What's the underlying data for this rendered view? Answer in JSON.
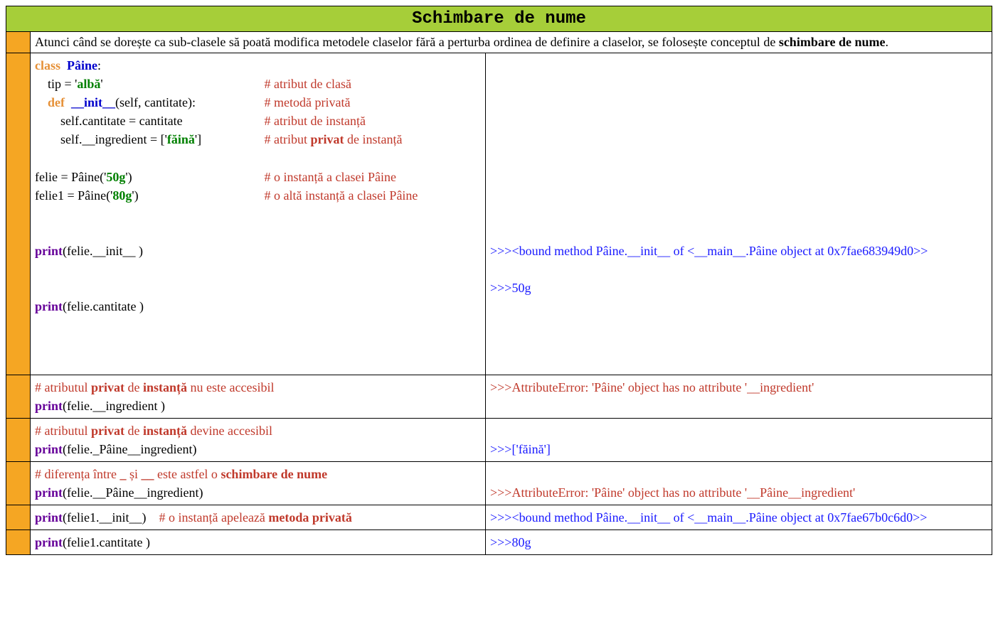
{
  "title": "Schimbare de nume",
  "intro": {
    "t1": "Atunci când se dorește ca sub-clasele să poată modifica metodele claselor fără a perturba ordinea de definire a claselor, se folosește conceptul de ",
    "t2": "schimbare de nume",
    "t3": "."
  },
  "code_main": {
    "l1_class": "class",
    "l1_name": "Pâine",
    "l1_colon": ":",
    "l2_lhs": "tip = '",
    "l2_val": "albă",
    "l2_rhs": "'",
    "l2_cmt": "# atribut de clasă",
    "l3_def": "def",
    "l3_fn": "__init__",
    "l3_sig": "(self, cantitate):",
    "l3_cmt": "# metodă privată",
    "l4_txt": "self.cantitate = cantitate",
    "l4_cmt": "# atribut de instanță",
    "l5_lhs": "self.__ingredient = ['",
    "l5_val": "făină",
    "l5_rhs": "']",
    "l5_cmt_a": "# atribut ",
    "l5_cmt_b": "privat",
    "l5_cmt_c": " de instanță",
    "l6_lhs": "felie = Pâine('",
    "l6_val": "50g",
    "l6_rhs": "')",
    "l6_cmt": "# o instanță a clasei Pâine",
    "l7_lhs": "felie1 = Pâine('",
    "l7_val": "80g",
    "l7_rhs": "')",
    "l7_cmt": "# o altă instanță a clasei Pâine",
    "l8_fn": "print",
    "l8_arg": "(felie.__init__ )",
    "l9_fn": "print",
    "l9_arg": "(felie.cantitate )"
  },
  "out_main": {
    "o1": ">>><bound method Pâine.__init__ of <__main__.Pâine object at 0x7fae683949d0>>",
    "o2": ">>>50g"
  },
  "row_err1": {
    "c1a": "# atributul ",
    "c1b": "privat",
    "c1c": " de ",
    "c1d": "instanță",
    "c1e": " nu este accesibil",
    "p_fn": "print",
    "p_arg": "(felie.__ingredient )",
    "out": ">>>AttributeError: 'Pâine' object has no attribute '__ingredient'"
  },
  "row_ok": {
    "c1a": "# atributul ",
    "c1b": "privat",
    "c1c": " de ",
    "c1d": "instanță",
    "c1e": " devine accesibil",
    "p_fn": "print",
    "p_arg": "(felie._Pâine__ingredient)",
    "out": ">>>['făină']"
  },
  "row_diff": {
    "c1a": "# diferența între ",
    "c1b": "_",
    "c1c": " și ",
    "c1d": "__",
    "c1e": " este astfel o ",
    "c1f": "schimbare de nume",
    "p_fn": "print",
    "p_arg": "(felie.__Pâine__ingredient)",
    "out": ">>>AttributeError: 'Pâine' object has no attribute '__Pâine__ingredient'"
  },
  "row_m2": {
    "p_fn": "print",
    "p_arg": "(felie1.__init__)",
    "c_a": "# o instanță apelează ",
    "c_b": "metoda privată",
    "out": ">>><bound method Pâine.__init__ of <__main__.Pâine object at 0x7fae67b0c6d0>>"
  },
  "row_last": {
    "p_fn": "print",
    "p_arg": "(felie1.cantitate )",
    "out": ">>>80g"
  }
}
